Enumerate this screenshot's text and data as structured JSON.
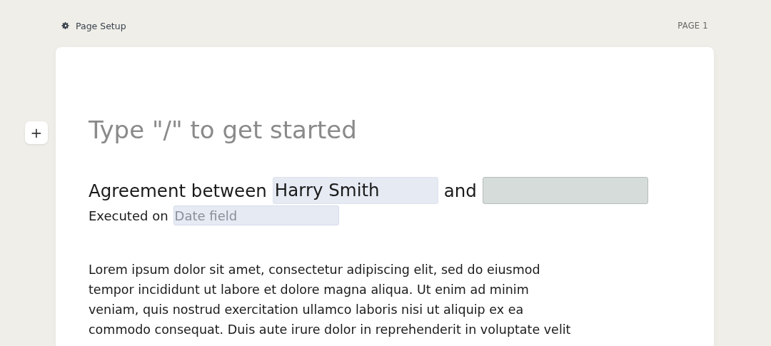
{
  "toolbar": {
    "page_setup": "Page Setup",
    "page_label": "PAGE 1"
  },
  "editor": {
    "add_button": "+",
    "placeholder": "Type \"/\" to get started",
    "agreement": {
      "prefix": "Agreement between",
      "fields": [
        {
          "value": "Harry Smith",
          "focused": false
        },
        {
          "focused": true
        }
      ],
      "joiner": "and"
    },
    "executed": {
      "label": "Executed on",
      "field": {
        "placeholder": "Date field"
      }
    },
    "body_lines": [
      "Lorem ipsum dolor sit amet, consectetur adipiscing elit, sed do eiusmod",
      "tempor incididunt ut labore et dolore magna aliqua. Ut enim ad minim",
      "veniam, quis nostrud exercitation ullamco laboris nisi ut aliquip ex ea",
      "commodo consequat. Duis aute irure dolor in reprehenderit in voluptate velit"
    ]
  }
}
